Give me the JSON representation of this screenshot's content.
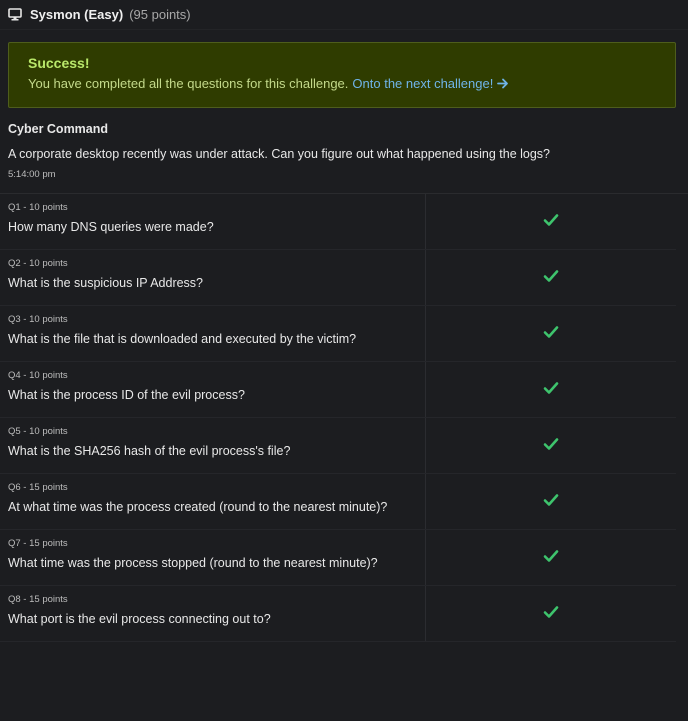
{
  "header": {
    "title": "Sysmon (Easy)",
    "points": "(95 points)"
  },
  "success": {
    "title": "Success!",
    "text": "You have completed all the questions for this challenge.",
    "link": "Onto the next challenge!"
  },
  "challenge": {
    "org": "Cyber Command",
    "description": "A corporate desktop recently was under attack. Can you figure out what happened using the logs?",
    "time": "5:14:00 pm"
  },
  "questions": [
    {
      "label": "Q1 - 10 points",
      "text": "How many DNS queries were made?",
      "status": "check-icon"
    },
    {
      "label": "Q2 - 10 points",
      "text": "What is the suspicious IP Address?",
      "status": "check-icon"
    },
    {
      "label": "Q3 - 10 points",
      "text": "What is the file that is downloaded and executed by the victim?",
      "status": "check-icon"
    },
    {
      "label": "Q4 - 10 points",
      "text": "What is the process ID of the evil process?",
      "status": "check-icon"
    },
    {
      "label": "Q5 - 10 points",
      "text": "What is the SHA256 hash of the evil process's file?",
      "status": "check-icon"
    },
    {
      "label": "Q6 - 15 points",
      "text": "At what time was the process created (round to the nearest minute)?",
      "status": "check-icon"
    },
    {
      "label": "Q7 - 15 points",
      "text": "What time was the process stopped (round to the nearest minute)?",
      "status": "check-icon"
    },
    {
      "label": "Q8 - 15 points",
      "text": "What port is the evil process connecting out to?",
      "status": "check-icon"
    }
  ],
  "colors": {
    "background": "#1c1d20",
    "success_bg": "#2f3c00",
    "success_title": "#b9e86a",
    "link": "#6fb4e8",
    "check": "#3ec46d"
  }
}
